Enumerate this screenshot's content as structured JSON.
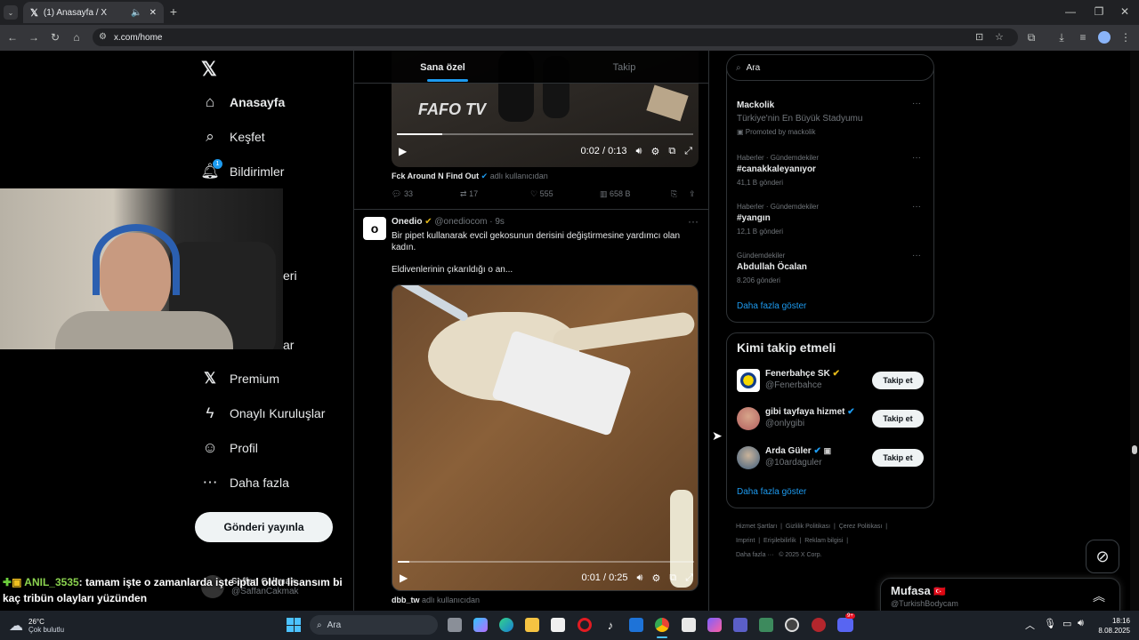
{
  "browser": {
    "tab_title": "(1) Anasayfa / X",
    "url": "x.com/home"
  },
  "nav": {
    "items": [
      {
        "label": "Anasayfa",
        "icon": "home-icon"
      },
      {
        "label": "Keşfet",
        "icon": "search-icon"
      },
      {
        "label": "Bildirimler",
        "icon": "bell-icon",
        "badge": "1"
      },
      {
        "label": "Premium",
        "icon": "x-icon"
      },
      {
        "label": "Onaylı Kuruluşlar",
        "icon": "lightning-icon"
      },
      {
        "label": "Profil",
        "icon": "person-icon"
      },
      {
        "label": "Daha fazla",
        "icon": "more-circle-icon"
      }
    ],
    "partial_label_1": "eri",
    "partial_label_2": "ar",
    "post_button": "Gönderi yayınla",
    "account_handle": "@SaffanCakmak",
    "account_name": "Saffan Çakmak"
  },
  "timeline": {
    "tab_for_you": "Sana özel",
    "tab_following": "Takip",
    "post1": {
      "video_time": "0:02 / 0:13",
      "video_watermark": "FAFO TV",
      "caption_name": "Fck Around N Find Out",
      "caption_suffix": "adlı kullanıcıdan",
      "replies": "33",
      "reposts": "17",
      "likes": "555",
      "views": "658 B"
    },
    "post2": {
      "name": "Onedio",
      "handle": "@onediocom",
      "time": "· 9s",
      "text1": "Bir pipet kullanarak evcil gekosunun derisini değiştirmesine yardımcı olan kadın.",
      "text2": "Eldivenlerinin çıkarıldığı o an...",
      "video_time": "0:01 / 0:25",
      "caption_name": "dbb_tw",
      "caption_suffix": "adlı kullanıcıdan"
    }
  },
  "search": {
    "placeholder": "Ara"
  },
  "trends": {
    "promo_name": "Mackolik",
    "promo_desc": "Türkiye'nin En Büyük Stadyumu",
    "promo_label": "Promoted by mackolik",
    "items": [
      {
        "category": "Haberler · Gündemdekiler",
        "name": "#canakkaleyanıyor",
        "count": "41,1 B gönderi"
      },
      {
        "category": "Haberler · Gündemdekiler",
        "name": "#yangın",
        "count": "12,1 B gönderi"
      },
      {
        "category": "Gündemdekiler",
        "name": "Abdullah Öcalan",
        "count": "8.206 gönderi"
      }
    ],
    "show_more": "Daha fazla göster"
  },
  "who_to_follow": {
    "title": "Kimi takip etmeli",
    "users": [
      {
        "name": "Fenerbahçe SK",
        "handle": "@Fenerbahce",
        "button": "Takip et"
      },
      {
        "name": "gibi tayfaya hizmet",
        "handle": "@onlygibi",
        "button": "Takip et"
      },
      {
        "name": "Arda Güler",
        "handle": "@10ardaguler",
        "button": "Takip et"
      }
    ],
    "show_more": "Daha fazla göster"
  },
  "footer": {
    "links": [
      "Hizmet Şartları",
      "Gizlilik Politikası",
      "Çerez Politikası",
      "Imprint",
      "Erişilebilirlik",
      "Reklam bilgisi",
      "Daha fazla ···",
      "© 2025 X Corp."
    ]
  },
  "messages_drawer": {
    "name": "Mufasa",
    "handle": "@TurkishBodycam",
    "flag": "🇹🇷"
  },
  "stream_overlay": {
    "chat_user": "ANIL_3535",
    "chat_text": ": tamam işte o zamanlarda işte iptal oldu lisansım bi kaç tribün olayları yüzünden"
  },
  "taskbar": {
    "weather_temp": "26°C",
    "weather_desc": "Çok bulutlu",
    "search_placeholder": "Ara",
    "time": "18:16",
    "date": "8.08.2025",
    "badge": "9+"
  },
  "colors": {
    "accent": "#1d9bf0",
    "background": "#000000",
    "border": "#2f3336",
    "muted": "#71767b",
    "chat_user": "#8bd34f"
  }
}
